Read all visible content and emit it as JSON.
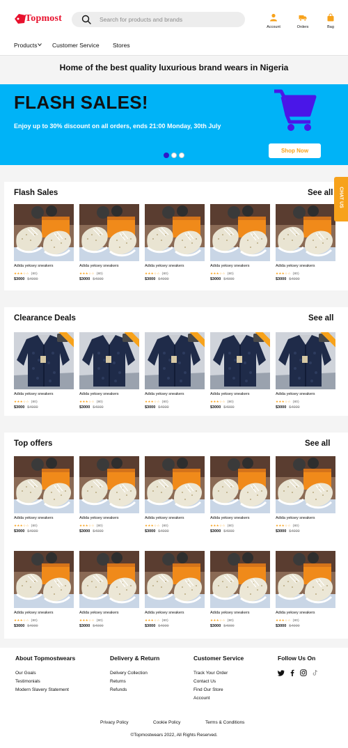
{
  "brand": {
    "logo_text": "Topmost",
    "accent": "#e8112d",
    "orange": "#f7a21b",
    "banner_bg": "#00b3f7",
    "cart_color": "#4a16e8"
  },
  "search": {
    "placeholder": "Search for products and brands",
    "icon": "search-icon"
  },
  "header_icons": [
    {
      "label": "Account",
      "icon": "user-icon"
    },
    {
      "label": "Orders",
      "icon": "truck-icon"
    },
    {
      "label": "Bag",
      "icon": "bag-icon"
    }
  ],
  "nav": {
    "products": "Products",
    "customer_service": "Customer Service",
    "stores": "Stores"
  },
  "tagline": "Home of the best quality luxurious brand wears in Nigeria",
  "banner": {
    "title": "FLASH SALES!",
    "subtitle": "Enjoy up to 30% discount on all orders, ends 21:00 Monday, 30th July",
    "button": "Shop Now",
    "slide_count": 3,
    "active_slide": 1
  },
  "chat": "CHAT US",
  "flash_sales": {
    "title": "Flash Sales",
    "see_all": "See all",
    "products": [
      {
        "name": "Adida yeksey sneakers",
        "rating": "★★★☆☆",
        "count": "(80)",
        "price": "$3000",
        "old_price": "$4000"
      },
      {
        "name": "Adida yeksey sneakers",
        "rating": "★★★☆☆",
        "count": "(80)",
        "price": "$3000",
        "old_price": "$4000"
      },
      {
        "name": "Adida yeksey sneakers",
        "rating": "★★★☆☆",
        "count": "(80)",
        "price": "$3000",
        "old_price": "$4000"
      },
      {
        "name": "Adida yeksey sneakers",
        "rating": "★★★☆☆",
        "count": "(80)",
        "price": "$3000",
        "old_price": "$4000"
      },
      {
        "name": "Adida yeksey sneakers",
        "rating": "★★★☆☆",
        "count": "(80)",
        "price": "$3000",
        "old_price": "$4000"
      }
    ]
  },
  "clearance": {
    "title": "Clearance Deals",
    "see_all": "See all",
    "products": [
      {
        "name": "Adida yeksey sneakers",
        "rating": "★★★☆☆",
        "count": "(80)",
        "price": "$3000",
        "old_price": "$4000"
      },
      {
        "name": "Adida yeksey sneakers",
        "rating": "★★★☆☆",
        "count": "(80)",
        "price": "$3000",
        "old_price": "$4000"
      },
      {
        "name": "Adida yeksey sneakers",
        "rating": "★★★☆☆",
        "count": "(80)",
        "price": "$3000",
        "old_price": "$4000"
      },
      {
        "name": "Adida yeksey sneakers",
        "rating": "★★★☆☆",
        "count": "(80)",
        "price": "$3000",
        "old_price": "$4000"
      },
      {
        "name": "Adida yeksey sneakers",
        "rating": "★★★☆☆",
        "count": "(80)",
        "price": "$3000",
        "old_price": "$4000"
      }
    ]
  },
  "top_offers": {
    "title": "Top offers",
    "see_all": "See all",
    "row1": [
      {
        "name": "Adida yeksey sneakers",
        "rating": "★★★☆☆",
        "count": "(80)",
        "price": "$3000",
        "old_price": "$4000"
      },
      {
        "name": "Adida yeksey sneakers",
        "rating": "★★★☆☆",
        "count": "(80)",
        "price": "$3000",
        "old_price": "$4000"
      },
      {
        "name": "Adida yeksey sneakers",
        "rating": "★★★☆☆",
        "count": "(80)",
        "price": "$3000",
        "old_price": "$4000"
      },
      {
        "name": "Adida yeksey sneakers",
        "rating": "★★★☆☆",
        "count": "(80)",
        "price": "$3000",
        "old_price": "$4000"
      },
      {
        "name": "Adida yeksey sneakers",
        "rating": "★★★☆☆",
        "count": "(80)",
        "price": "$3000",
        "old_price": "$4000"
      }
    ],
    "row2": [
      {
        "name": "Adida yeksey sneakers",
        "rating": "★★★☆☆",
        "count": "(80)",
        "price": "$3000",
        "old_price": "$4000"
      },
      {
        "name": "Adida yeksey sneakers",
        "rating": "★★★☆☆",
        "count": "(80)",
        "price": "$3000",
        "old_price": "$4000"
      },
      {
        "name": "Adida yeksey sneakers",
        "rating": "★★★☆☆",
        "count": "(80)",
        "price": "$3000",
        "old_price": "$4000"
      },
      {
        "name": "Adida yeksey sneakers",
        "rating": "★★★☆☆",
        "count": "(80)",
        "price": "$3000",
        "old_price": "$4000"
      },
      {
        "name": "Adida yeksey sneakers",
        "rating": "★★★☆☆",
        "count": "(80)",
        "price": "$3000",
        "old_price": "$4000"
      }
    ]
  },
  "footer": {
    "about": {
      "title": "About Topmostwears",
      "links": [
        "Our Goals",
        "Testimonials",
        "Modern Slavery Statement"
      ]
    },
    "delivery": {
      "title": "Delivery & Return",
      "links": [
        "Delivery Collection",
        "Returns",
        "Refunds"
      ]
    },
    "customer_service": {
      "title": "Customer Service",
      "links": [
        "Track Your Order",
        "Contact Us",
        "Find Our Store",
        "Account"
      ]
    },
    "follow": {
      "title": "Follow Us On",
      "icons": [
        "twitter-icon",
        "facebook-icon",
        "instagram-icon",
        "tiktok-icon"
      ]
    },
    "bottom_links": [
      "Privacy Policy",
      "Cookie Policy",
      "Terms & Conditions"
    ],
    "copyright": "©Topmostwears 2022, All Rights Reserved."
  }
}
